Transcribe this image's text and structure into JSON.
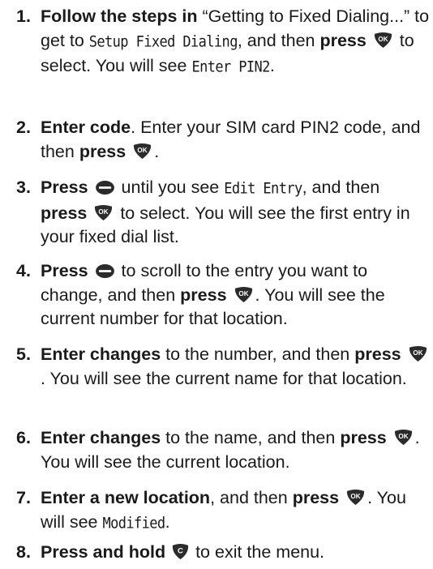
{
  "steps": [
    {
      "number": "1.",
      "bold": "Follow the steps in",
      "text_a": " “Getting to Fixed Dialing...” to get to ",
      "lcd_a": "Setup Fixed Dialing",
      "text_b": ", and then ",
      "bold_b": "press",
      "key": "ok-icon",
      "text_c": " to select. You will see ",
      "lcd_b": "Enter PIN2",
      "text_d": "."
    },
    {
      "number": "2.",
      "bold": "Enter code",
      "text_a": ". Enter your SIM card PIN2 code, and then ",
      "bold_b": "press",
      "key": "ok-icon",
      "text_b": "."
    },
    {
      "number": "3.",
      "bold": "Press",
      "key_a": "menu-icon",
      "text_a": " until you see ",
      "lcd_a": "Edit Entry",
      "text_b": ", and then ",
      "bold_b": "press",
      "key_b": "ok-icon",
      "text_c": " to select. You will see the first entry in your fixed dial list."
    },
    {
      "number": "4.",
      "bold": "Press",
      "key_a": "menu-icon",
      "text_a": " to scroll to the entry you want to change, and then ",
      "bold_b": "press",
      "key_b": "ok-icon",
      "text_b": ". You will see the current number for that location."
    },
    {
      "number": "5.",
      "bold": "Enter changes",
      "text_a": " to the number, and then ",
      "bold_b": "press",
      "key": "ok-icon",
      "text_b": ". You will see the current name for that location."
    },
    {
      "number": "6.",
      "bold": "Enter changes",
      "text_a": " to the name, and then ",
      "bold_b": "press",
      "key": "ok-icon",
      "text_b": ". You will see the current location."
    },
    {
      "number": "7.",
      "bold": "Enter a new location",
      "text_a": ", and then ",
      "bold_b": "press",
      "key": "ok-icon",
      "text_b": ". You will see ",
      "lcd_a": "Modified",
      "text_c": "."
    },
    {
      "number": "8.",
      "bold": "Press and hold",
      "key": "clear-icon",
      "text_a": " to exit the menu."
    }
  ],
  "colors": {
    "text": "#1a1a1a",
    "key_fill": "#2b2b2b",
    "key_label": "#ffffff"
  }
}
